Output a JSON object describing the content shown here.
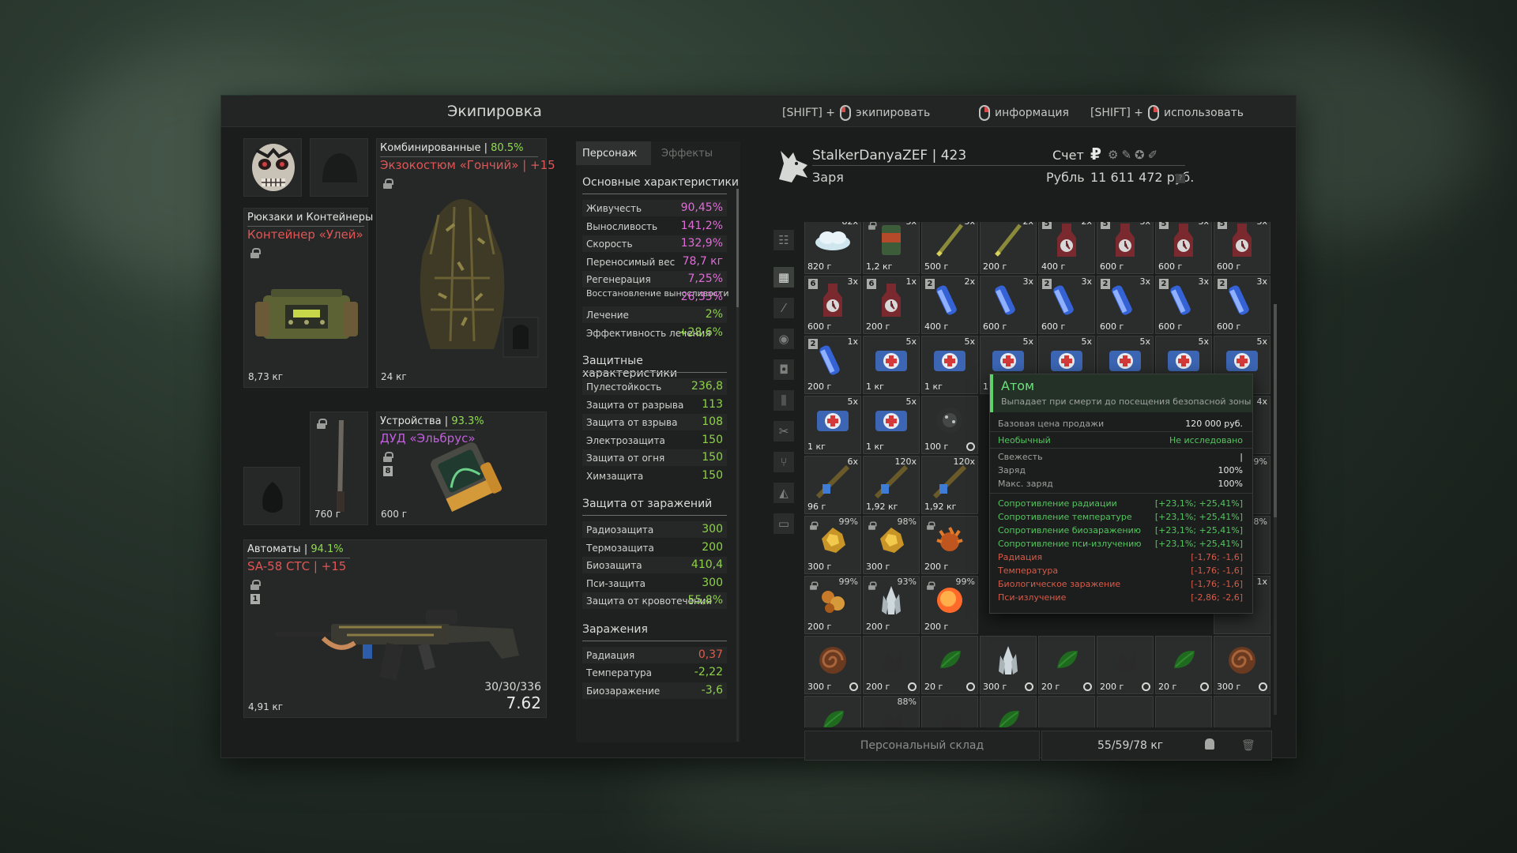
{
  "window": {
    "title": "Экипировка",
    "hints": [
      {
        "prefix": "[SHIFT] +",
        "label": "экипировать",
        "mouse": "left-mouse-icon"
      },
      {
        "prefix": "",
        "label": "информация",
        "mouse": "right-mouse-icon"
      },
      {
        "prefix": "[SHIFT] +",
        "label": "использовать",
        "mouse": "right-mouse-icon"
      }
    ]
  },
  "equipment": {
    "combined": {
      "category": "Комбинированные |",
      "pct": "80.5%",
      "name": "Экзокостюм «Гончий» | +15",
      "weight": "24 кг"
    },
    "backpack": {
      "category": "Рюкзаки и Контейнеры",
      "name": "Контейнер «Улей»",
      "weight": "8,73 кг"
    },
    "device": {
      "category": "Устройства |",
      "pct": "93.3%",
      "name": "ДУД «Эльбрус»",
      "weight": "600 г",
      "badge": "8"
    },
    "melee": {
      "weight": "760 г"
    },
    "rifle": {
      "category": "Автоматы |",
      "pct": "94.1%",
      "name": "SA-58 СТС | +15",
      "weight": "4,91 кг",
      "ammo": "30/30/336",
      "caliber": "7.62",
      "badge": "1"
    }
  },
  "stats_panel": {
    "tabs": [
      "Персонаж",
      "Эффекты"
    ],
    "sections": [
      {
        "title": "Основные характеристики",
        "rows": [
          {
            "label": "Живучесть",
            "value": "90,45%",
            "color": "#e06cd8"
          },
          {
            "label": "Выносливость",
            "value": "141,2%",
            "color": "#e06cd8"
          },
          {
            "label": "Скорость",
            "value": "132,9%",
            "color": "#e06cd8"
          },
          {
            "label": "Переносимый вес",
            "value": "78,7 кг",
            "color": "#e06cd8"
          },
          {
            "label": "Регенерация",
            "value": "7,25%",
            "color": "#e06cd8"
          },
          {
            "label": "Восстановление выносливости",
            "value": "26,33%",
            "color": "#e06cd8"
          },
          {
            "label": "Лечение",
            "value": "2%",
            "color": "#8fd24a"
          },
          {
            "label": "Эффективность лечения",
            "value": "+28,6%",
            "color": "#8fd24a"
          }
        ]
      },
      {
        "title": "Защитные характеристики",
        "rows": [
          {
            "label": "Пулестойкость",
            "value": "236,8",
            "color": "#8fd24a"
          },
          {
            "label": "Защита от разрыва",
            "value": "113",
            "color": "#8fd24a"
          },
          {
            "label": "Защита от взрыва",
            "value": "108",
            "color": "#8fd24a"
          },
          {
            "label": "Электрозащита",
            "value": "150",
            "color": "#8fd24a"
          },
          {
            "label": "Защита от огня",
            "value": "150",
            "color": "#8fd24a"
          },
          {
            "label": "Химзащита",
            "value": "150",
            "color": "#8fd24a"
          }
        ]
      },
      {
        "title": "Защита от заражений",
        "rows": [
          {
            "label": "Радиозащита",
            "value": "300",
            "color": "#8fd24a"
          },
          {
            "label": "Термозащита",
            "value": "200",
            "color": "#8fd24a"
          },
          {
            "label": "Биозащита",
            "value": "410,4",
            "color": "#8fd24a"
          },
          {
            "label": "Пси-защита",
            "value": "300",
            "color": "#8fd24a"
          },
          {
            "label": "Защита от кровотечения",
            "value": "55,8%",
            "color": "#8fd24a"
          }
        ]
      },
      {
        "title": "Заражения",
        "rows": [
          {
            "label": "Радиация",
            "value": "0,37",
            "color": "#e25b4a"
          },
          {
            "label": "Температура",
            "value": "-2,22",
            "color": "#8fd24a"
          },
          {
            "label": "Биозаражение",
            "value": "-3,6",
            "color": "#8fd24a"
          }
        ]
      }
    ]
  },
  "player": {
    "name": "StalkerDanyaZEF | 423",
    "faction": "Заря",
    "account_label": "Счет",
    "currency_label": "Рубль",
    "balance": "11 611 472 руб."
  },
  "inventory": {
    "rows": [
      [
        {
          "q": "82x",
          "p": "820 г",
          "t": "cloud"
        },
        {
          "q": "3x",
          "p": "1,2 кг",
          "t": "can",
          "lock": true
        },
        {
          "q": "5x",
          "p": "500 г",
          "t": "stick"
        },
        {
          "q": "2x",
          "p": "200 г",
          "t": "stick"
        },
        {
          "q": "2x",
          "p": "400 г",
          "t": "bottle",
          "b": "5"
        },
        {
          "q": "3x",
          "p": "600 г",
          "t": "bottle",
          "b": "5"
        },
        {
          "q": "3x",
          "p": "600 г",
          "t": "bottle",
          "b": "5"
        },
        {
          "q": "3x",
          "p": "600 г",
          "t": "bottle",
          "b": "5"
        }
      ],
      [
        {
          "q": "3x",
          "p": "600 г",
          "t": "bottle",
          "b": "6"
        },
        {
          "q": "1x",
          "p": "200 г",
          "t": "bottle",
          "b": "6"
        },
        {
          "q": "2x",
          "p": "400 г",
          "t": "syringe",
          "b": "2"
        },
        {
          "q": "3x",
          "p": "600 г",
          "t": "syringe"
        },
        {
          "q": "3x",
          "p": "600 г",
          "t": "syringe",
          "b": "2"
        },
        {
          "q": "3x",
          "p": "600 г",
          "t": "syringe",
          "b": "2"
        },
        {
          "q": "3x",
          "p": "600 г",
          "t": "syringe",
          "b": "2"
        },
        {
          "q": "3x",
          "p": "600 г",
          "t": "syringe",
          "b": "2"
        }
      ],
      [
        {
          "q": "1x",
          "p": "200 г",
          "t": "syringe",
          "b": "2"
        },
        {
          "q": "5x",
          "p": "1 кг",
          "t": "medkit"
        },
        {
          "q": "5x",
          "p": "1 кг",
          "t": "medkit"
        },
        {
          "q": "5x",
          "p": "1 кг",
          "t": "medkit"
        },
        {
          "q": "5x",
          "p": "1 кг",
          "t": "medkit"
        },
        {
          "q": "5x",
          "p": "1 кг",
          "t": "medkit"
        },
        {
          "q": "5x",
          "p": "1 кг",
          "t": "medkit"
        },
        {
          "q": "5x",
          "p": "1 кг",
          "t": "medkit"
        }
      ],
      [
        {
          "q": "5x",
          "p": "1 кг",
          "t": "medkit"
        },
        {
          "q": "5x",
          "p": "1 кг",
          "t": "medkit"
        },
        {
          "q": "",
          "p": "100 г",
          "t": "atom",
          "clock": true
        },
        null,
        null,
        null,
        null,
        {
          "q": "4x",
          "p": "",
          "t": "creature"
        }
      ],
      [
        {
          "q": "6x",
          "p": "96 г",
          "t": "flute"
        },
        {
          "q": "120x",
          "p": "1,92 кг",
          "t": "flute"
        },
        {
          "q": "120x",
          "p": "1,92 кг",
          "t": "flute"
        },
        null,
        null,
        null,
        null,
        {
          "pct": "99%",
          "p": "",
          "t": "crystal-blue"
        }
      ],
      [
        {
          "pct": "99%",
          "p": "300 г",
          "t": "gold",
          "lock": true
        },
        {
          "pct": "98%",
          "p": "300 г",
          "t": "gold",
          "lock": true
        },
        {
          "pct": "",
          "p": "200 г",
          "t": "spiky",
          "lock": true
        },
        null,
        null,
        null,
        null,
        {
          "pct": "98%",
          "p": "",
          "t": "shard"
        }
      ],
      [
        {
          "pct": "99%",
          "p": "200 г",
          "t": "gold-cluster",
          "lock": true
        },
        {
          "pct": "93%",
          "p": "200 г",
          "t": "crystal",
          "lock": true
        },
        {
          "pct": "99%",
          "p": "200 г",
          "t": "fireball",
          "lock": true
        },
        null,
        null,
        null,
        null,
        {
          "q": "1x",
          "p": "",
          "t": "purple"
        }
      ],
      [
        {
          "p": "300 г",
          "t": "spiral",
          "clock": true
        },
        {
          "p": "200 г",
          "t": "dark",
          "clock": true
        },
        {
          "p": "20 г",
          "t": "leaf",
          "clock": true
        },
        {
          "p": "300 г",
          "t": "crystal",
          "clock": true
        },
        {
          "p": "20 г",
          "t": "leaf",
          "clock": true
        },
        {
          "p": "200 г",
          "t": "dark",
          "clock": true
        },
        {
          "p": "20 г",
          "t": "leaf",
          "clock": true
        },
        {
          "p": "300 г",
          "t": "spiral",
          "clock": true
        }
      ],
      [
        {
          "p": "",
          "t": "leaf"
        },
        {
          "pct": "88%",
          "p": "",
          "t": "dark"
        },
        {
          "p": "",
          "t": "dark"
        },
        {
          "p": "",
          "t": "leaf"
        },
        {
          "p": "",
          "t": "empty"
        },
        {
          "p": "",
          "t": "empty"
        },
        {
          "p": "",
          "t": "empty"
        },
        {
          "p": "",
          "t": "empty"
        }
      ]
    ],
    "storage_label": "Персональный склад",
    "weight": "55/59/78 кг"
  },
  "tooltip": {
    "name": "Атом",
    "description": "Выпадает при смерти до посещения безопасной зоны",
    "base_price_label": "Базовая цена продажи",
    "base_price": "120 000 руб.",
    "rarity": "Необычный",
    "research": "Не исследовано",
    "props": [
      {
        "label": "Свежесть",
        "value": "|"
      },
      {
        "label": "Заряд",
        "value": "100%"
      },
      {
        "label": "Макс. заряд",
        "value": "100%"
      }
    ],
    "effects": [
      {
        "label": "Сопротивление радиации",
        "value": "[+23,1%; +25,41%]",
        "kind": "pos"
      },
      {
        "label": "Сопротивление температуре",
        "value": "[+23,1%; +25,41%]",
        "kind": "pos"
      },
      {
        "label": "Сопротивление биозаражению",
        "value": "[+23,1%; +25,41%]",
        "kind": "pos"
      },
      {
        "label": "Сопротивление пси-излучению",
        "value": "[+23,1%; +25,41%]",
        "kind": "pos"
      },
      {
        "label": "Радиация",
        "value": "[-1,76; -1,6]",
        "kind": "neg"
      },
      {
        "label": "Температура",
        "value": "[-1,76; -1,6]",
        "kind": "neg"
      },
      {
        "label": "Биологическое заражение",
        "value": "[-1,76; -1,6]",
        "kind": "neg"
      },
      {
        "label": "Пси-излучение",
        "value": "[-2,86; -2,6]",
        "kind": "neg"
      }
    ]
  }
}
